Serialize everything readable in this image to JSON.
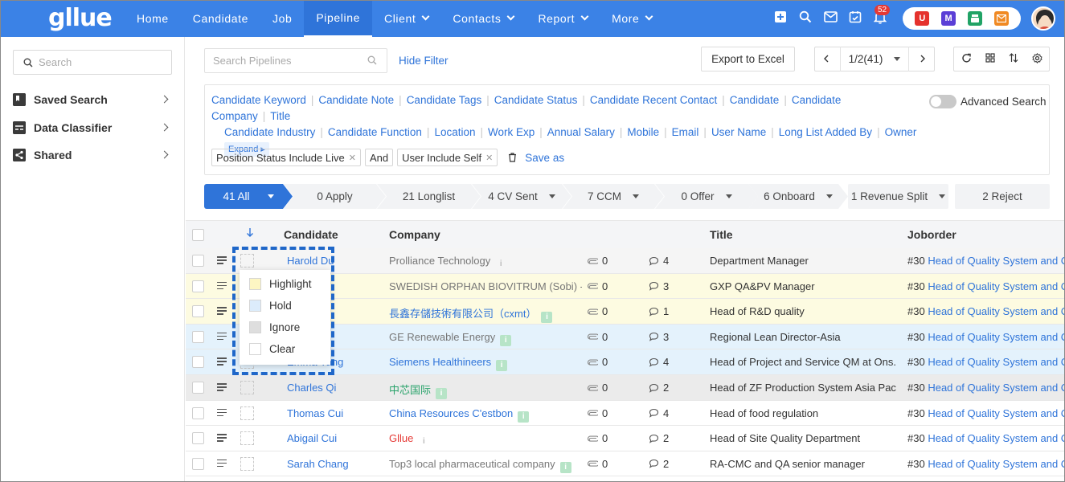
{
  "brand": {
    "logo": "gllue"
  },
  "nav": {
    "items": [
      {
        "label": "Home",
        "dropdown": false,
        "active": false
      },
      {
        "label": "Candidate",
        "dropdown": false,
        "active": false
      },
      {
        "label": "Job",
        "dropdown": false,
        "active": false
      },
      {
        "label": "Pipeline",
        "dropdown": false,
        "active": true
      },
      {
        "label": "Client",
        "dropdown": true,
        "active": false
      },
      {
        "label": "Contacts",
        "dropdown": true,
        "active": false
      },
      {
        "label": "Report",
        "dropdown": true,
        "active": false
      },
      {
        "label": "More",
        "dropdown": true,
        "active": false
      }
    ],
    "icons": [
      "add-square-icon",
      "search-icon",
      "mail-icon",
      "calendar-check-icon",
      "bell-icon"
    ],
    "notification_count": "52",
    "apps": [
      {
        "letter": "U",
        "color": "#e5322d"
      },
      {
        "letter": "M",
        "color": "#5b3fd6"
      },
      {
        "letter": "",
        "color": "#21a366"
      },
      {
        "letter": "",
        "color": "#f08a24"
      }
    ]
  },
  "sidebar": {
    "search_placeholder": "Search",
    "items": [
      {
        "label": "Saved Search",
        "icon": "bookmark-icon"
      },
      {
        "label": "Data Classifier",
        "icon": "classifier-icon"
      },
      {
        "label": "Shared",
        "icon": "share-icon"
      }
    ]
  },
  "toolbar": {
    "search_placeholder": "Search Pipelines",
    "hide_filter": "Hide Filter",
    "export": "Export to Excel",
    "pagination": "1/2(41)"
  },
  "filters": {
    "fields": [
      "Candidate Keyword",
      "Candidate Note",
      "Candidate Tags",
      "Candidate Status",
      "Candidate Recent Contact",
      "Candidate",
      "Candidate Company",
      "Title",
      "Candidate Industry",
      "Candidate Function",
      "Location",
      "Work Exp",
      "Annual Salary",
      "Mobile",
      "Email",
      "User Name",
      "Long List Added By",
      "Owner"
    ],
    "expand": "Expand",
    "advanced_search": "Advanced Search",
    "chips": [
      "Position Status Include Live",
      "And",
      "User Include Self"
    ],
    "save_as": "Save as"
  },
  "stages": [
    {
      "label": "41 All",
      "dropdown": true
    },
    {
      "label": "0 Apply",
      "dropdown": false
    },
    {
      "label": "21 Longlist",
      "dropdown": false
    },
    {
      "label": "4 CV Sent",
      "dropdown": true
    },
    {
      "label": "7 CCM",
      "dropdown": true
    },
    {
      "label": "0 Offer",
      "dropdown": true
    },
    {
      "label": "6 Onboard",
      "dropdown": true
    },
    {
      "label": "1 Revenue Split",
      "dropdown": true
    },
    {
      "label": "2 Reject",
      "dropdown": false
    }
  ],
  "table": {
    "sort_icon": "arrow-down-icon",
    "headers": {
      "candidate": "Candidate",
      "company": "Company",
      "title": "Title",
      "joborder": "Joborder"
    },
    "rows": [
      {
        "candidate": "Harold Du",
        "company": "Prolliance Technology",
        "company_style": "gray",
        "info": "light",
        "attach": "0",
        "comments": "4",
        "title": "Department Manager",
        "job_no": "#30",
        "job": "Head of Quality System and Co",
        "bg": "#f5f5f5"
      },
      {
        "candidate": "",
        "company": "SWEDISH ORPHAN BIOVITRUM (Sobi) - CI",
        "company_style": "gray",
        "info": "none",
        "attach": "0",
        "comments": "3",
        "title": "GXP QA&PV Manager",
        "job_no": "#30",
        "job": "Head of Quality System and Co",
        "bg": "#fdfbe1"
      },
      {
        "candidate": "ng",
        "company": "長鑫存儲技術有限公司（cxmt）",
        "company_style": "blue",
        "info": "green",
        "attach": "0",
        "comments": "1",
        "title": "Head of R&D quality",
        "job_no": "#30",
        "job": "Head of Quality System and Co",
        "bg": "#fdfbe1"
      },
      {
        "candidate": "u",
        "company": "GE Renewable Energy",
        "company_style": "gray",
        "info": "green",
        "attach": "0",
        "comments": "3",
        "title": "Regional Lean Director-Asia",
        "job_no": "#30",
        "job": "Head of Quality System and Co",
        "bg": "#e4f2fc"
      },
      {
        "candidate": "Emma Yang",
        "company": "Siemens Healthineers",
        "company_style": "blue",
        "info": "green",
        "attach": "0",
        "comments": "4",
        "title": "Head of Project and Service QM at Ons...",
        "job_no": "#30",
        "job": "Head of Quality System and Co",
        "bg": "#e4f2fc"
      },
      {
        "candidate": "Charles Qi",
        "company": "中芯国际",
        "company_style": "green",
        "info": "green",
        "attach": "0",
        "comments": "2",
        "title": "Head of ZF Production System Asia Pac...",
        "job_no": "#30",
        "job": "Head of Quality System and Co",
        "bg": "#ebebeb"
      },
      {
        "candidate": "Thomas Cui",
        "company": "China Resources C'estbon",
        "company_style": "blue",
        "info": "green",
        "attach": "0",
        "comments": "4",
        "title": "Head of food regulation",
        "job_no": "#30",
        "job": "Head of Quality System and Co",
        "bg": "#ffffff"
      },
      {
        "candidate": "Abigail Cui",
        "company": "Gllue",
        "company_style": "red",
        "info": "light",
        "attach": "0",
        "comments": "2",
        "title": "Head of Site Quality Department",
        "job_no": "#30",
        "job": "Head of Quality System and Co",
        "bg": "#ffffff"
      },
      {
        "candidate": "Sarah Chang",
        "company": "Top3 local pharmaceutical company",
        "company_style": "gray",
        "info": "green",
        "attach": "0",
        "comments": "2",
        "title": "RA-CMC and QA senior manager",
        "job_no": "#30",
        "job": "Head of Quality System and Co",
        "bg": "#ffffff"
      }
    ]
  },
  "popup": {
    "items": [
      {
        "label": "Highlight",
        "color": "#fdf6c3"
      },
      {
        "label": "Hold",
        "color": "#dcecfb"
      },
      {
        "label": "Ignore",
        "color": "#dedede"
      },
      {
        "label": "Clear",
        "color": "#ffffff"
      }
    ]
  }
}
